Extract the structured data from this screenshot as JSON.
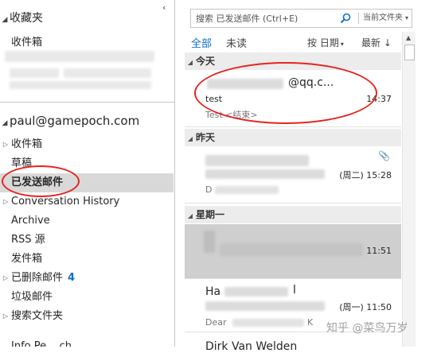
{
  "folder_pane": {
    "collapse_glyph": "‹",
    "favorites_label": "收藏夹",
    "favorites_inbox": "收件箱",
    "account": "paul@gamepoch.com",
    "folders": [
      {
        "label": "收件箱",
        "expandable": true
      },
      {
        "label": "草稿",
        "expandable": false
      },
      {
        "label": "已发送邮件",
        "expandable": false,
        "selected": true
      },
      {
        "label": "Conversation History",
        "expandable": true
      },
      {
        "label": "Archive",
        "expandable": false
      },
      {
        "label": "RSS 源",
        "expandable": false
      },
      {
        "label": "发件箱",
        "expandable": false
      },
      {
        "label": "已删除邮件",
        "expandable": true,
        "count": "4"
      },
      {
        "label": "垃圾邮件",
        "expandable": false
      },
      {
        "label": "搜索文件夹",
        "expandable": true
      }
    ],
    "bottom_partial": "Info Pe....ch..."
  },
  "search": {
    "placeholder": "搜索 已发送邮件 (Ctrl+E)",
    "scope": "当前文件夹"
  },
  "filters": {
    "all": "全部",
    "unread": "未读",
    "sort": "按 日期",
    "order": "最新 ↓"
  },
  "groups": {
    "today": "今天",
    "yesterday": "昨天",
    "monday": "星期一"
  },
  "messages": {
    "m1": {
      "sender": "@qq.c...",
      "subject": "test",
      "time": "14:37",
      "preview": "Test <结束>"
    },
    "m2": {
      "time": "(周二) 15:28",
      "preview": "D"
    },
    "m3": {
      "time": "11:51"
    },
    "m4": {
      "sender": "Ha",
      "sender_tail": "l",
      "time": "(周一) 11:50",
      "preview": "Dear",
      "preview_tail": "K"
    },
    "m5": {
      "sender": "Dirk Van Welden"
    }
  },
  "watermark": "知乎 @菜鸟万岁",
  "colors": {
    "accent": "#0f6fc6",
    "annotation": "#e52420",
    "selected_bg": "#d9d9d9"
  }
}
